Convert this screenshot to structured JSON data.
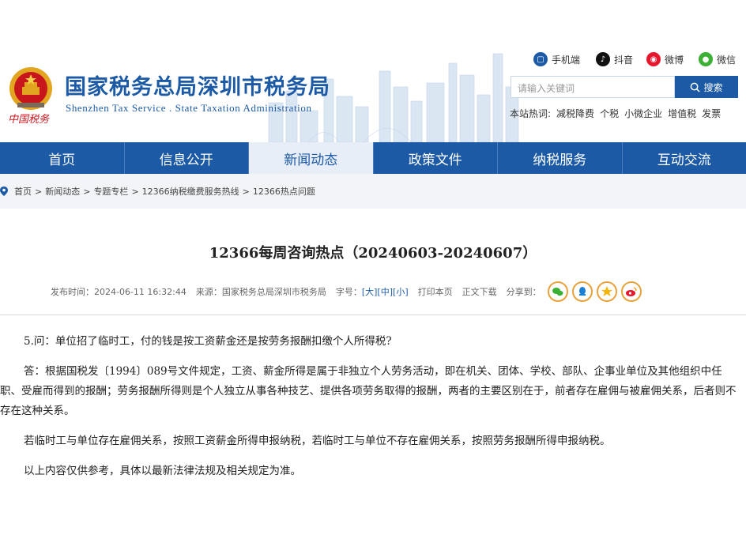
{
  "header": {
    "title": "国家税务总局深圳市税务局",
    "subtitle": "Shenzhen  Tax  Service . State  Taxation  Administration",
    "emblem_caption": "中国税务",
    "social": [
      {
        "label": "手机端",
        "icon": "mobile-icon",
        "color": "#1c5aa6"
      },
      {
        "label": "抖音",
        "icon": "douyin-icon",
        "color": "#111111"
      },
      {
        "label": "微博",
        "icon": "weibo-icon",
        "color": "#e6162d"
      },
      {
        "label": "微信",
        "icon": "wechat-icon",
        "color": "#3cb034"
      }
    ],
    "search": {
      "placeholder": "请输入关键词",
      "button": "搜索"
    },
    "hot": {
      "label": "本站热词:",
      "words": [
        "减税降费",
        "个税",
        "小微企业",
        "增值税",
        "发票"
      ]
    }
  },
  "nav": {
    "items": [
      {
        "label": "首页",
        "active": false
      },
      {
        "label": "信息公开",
        "active": false
      },
      {
        "label": "新闻动态",
        "active": true
      },
      {
        "label": "政策文件",
        "active": false
      },
      {
        "label": "纳税服务",
        "active": false
      },
      {
        "label": "互动交流",
        "active": false
      }
    ]
  },
  "breadcrumb": [
    "首页",
    "新闻动态",
    "专题专栏",
    "12366纳税缴费服务热线",
    "12366热点问题"
  ],
  "article": {
    "title": "12366每周咨询热点（20240603-20240607）",
    "meta": {
      "publish_label": "发布时间：",
      "publish_time": "2024-06-11 16:32:44",
      "source_label": "来源：",
      "source": "国家税务总局深圳市税务局",
      "font_label": "字号：",
      "size_large": "大",
      "size_medium": "中",
      "size_small": "小",
      "print": "打印本页",
      "download": "正文下载",
      "share_label": "分享到："
    },
    "share_icons": [
      "wechat-share-icon",
      "qq-share-icon",
      "qzone-share-icon",
      "weibo-share-icon"
    ],
    "question": "5.问：单位招了临时工，付的钱是按工资薪金还是按劳务报酬扣缴个人所得税?",
    "answer": "答：根据国税发〔1994〕089号文件规定，工资、薪金所得是属于非独立个人劳务活动，即在机关、团体、学校、部队、企事业单位及其他组织中任职、受雇而得到的报酬；劳务报酬所得则是个人独立从事各种技艺、提供各项劳务取得的报酬，两者的主要区别在于，前者存在雇佣与被雇佣关系，后者则不存在这种关系。",
    "para2": "若临时工与单位存在雇佣关系，按照工资薪金所得申报纳税，若临时工与单位不存在雇佣关系，按照劳务报酬所得申报纳税。",
    "para3": "以上内容仅供参考，具体以最新法律法规及相关规定为准。"
  }
}
